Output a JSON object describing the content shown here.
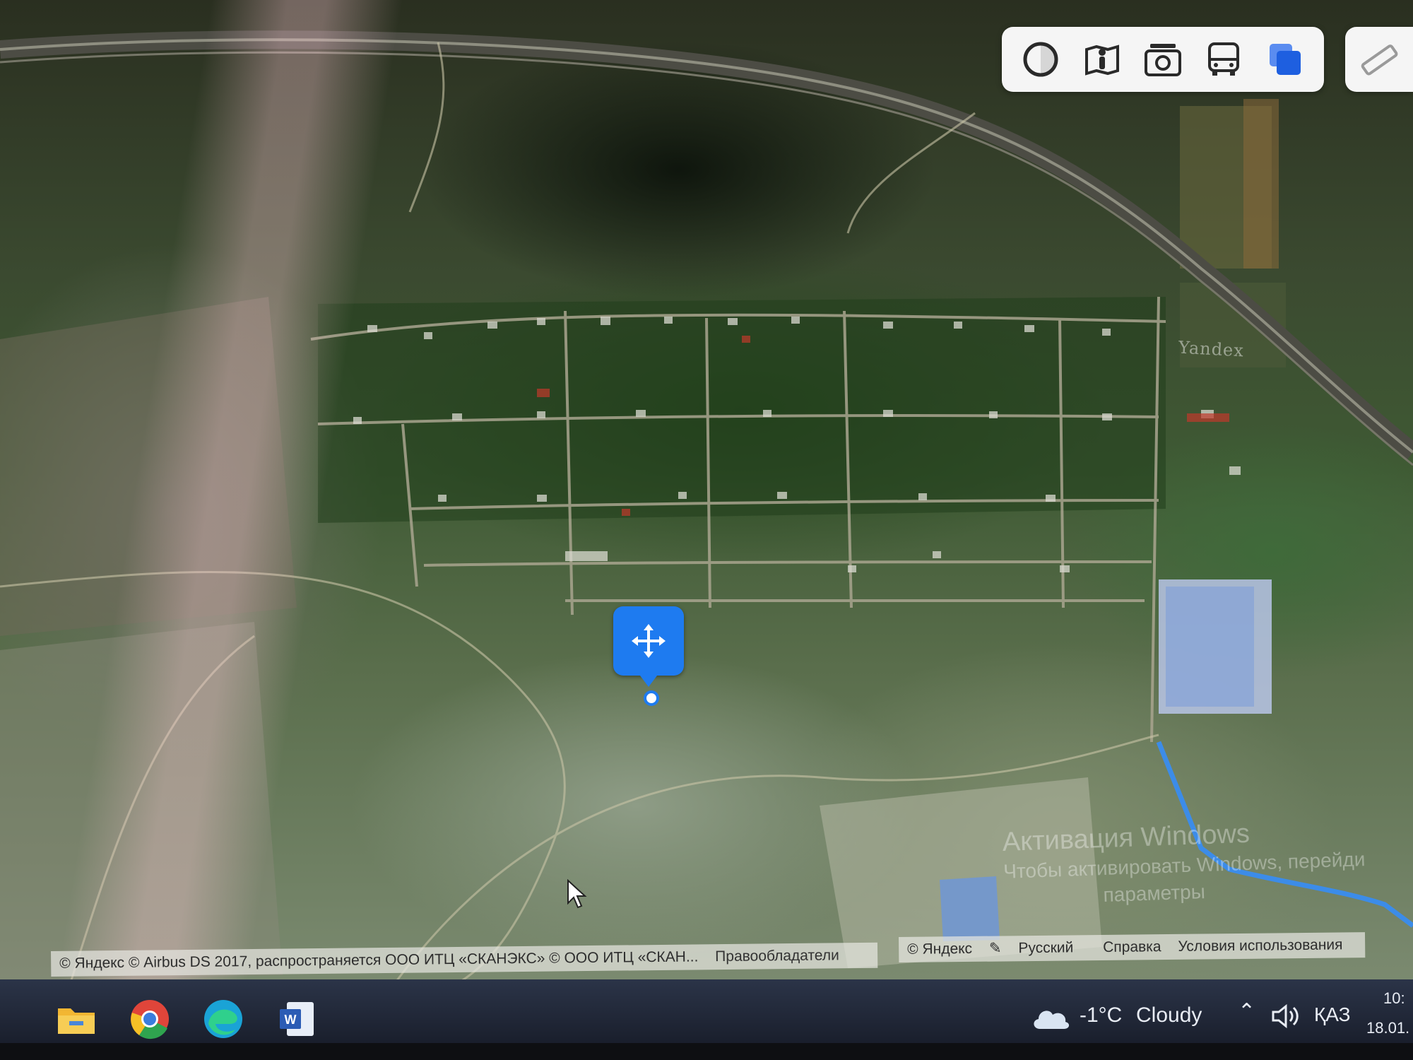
{
  "map": {
    "watermark": "Yandex",
    "activation_notice": {
      "line1": "Активация Windows",
      "line2": "Чтобы активировать Windows, перейди",
      "line3": "параметры"
    }
  },
  "toolbar": {
    "tools": [
      {
        "icon": "layers-circle-icon"
      },
      {
        "icon": "panorama-man-icon"
      },
      {
        "icon": "camera-icon"
      },
      {
        "icon": "bus-icon"
      },
      {
        "icon": "map-layers-icon"
      }
    ],
    "ruler_icon": "ruler-icon"
  },
  "copyright": {
    "text": "© Яндекс © Airbus DS 2017, распространяется ООО ИТЦ «СКАНЭКС» © ООО ИТЦ «СКАН...",
    "rights_link": "Правообладатели"
  },
  "footer_links": {
    "yandex": "© Яндекс",
    "language": "Русский",
    "help": "Справка",
    "terms": "Условия использования"
  },
  "taskbar": {
    "apps": [
      "file-explorer-icon",
      "chrome-icon",
      "edge-icon",
      "word-icon"
    ],
    "weather": {
      "temp": "-1°C",
      "condition": "Cloudy"
    },
    "language": "ҚАЗ",
    "time": "10:",
    "date": "18.01."
  },
  "colors": {
    "accent": "#1e7bf0",
    "toolbar_bg": "#f5f5f5",
    "taskbar_bg": "#1e2433"
  }
}
